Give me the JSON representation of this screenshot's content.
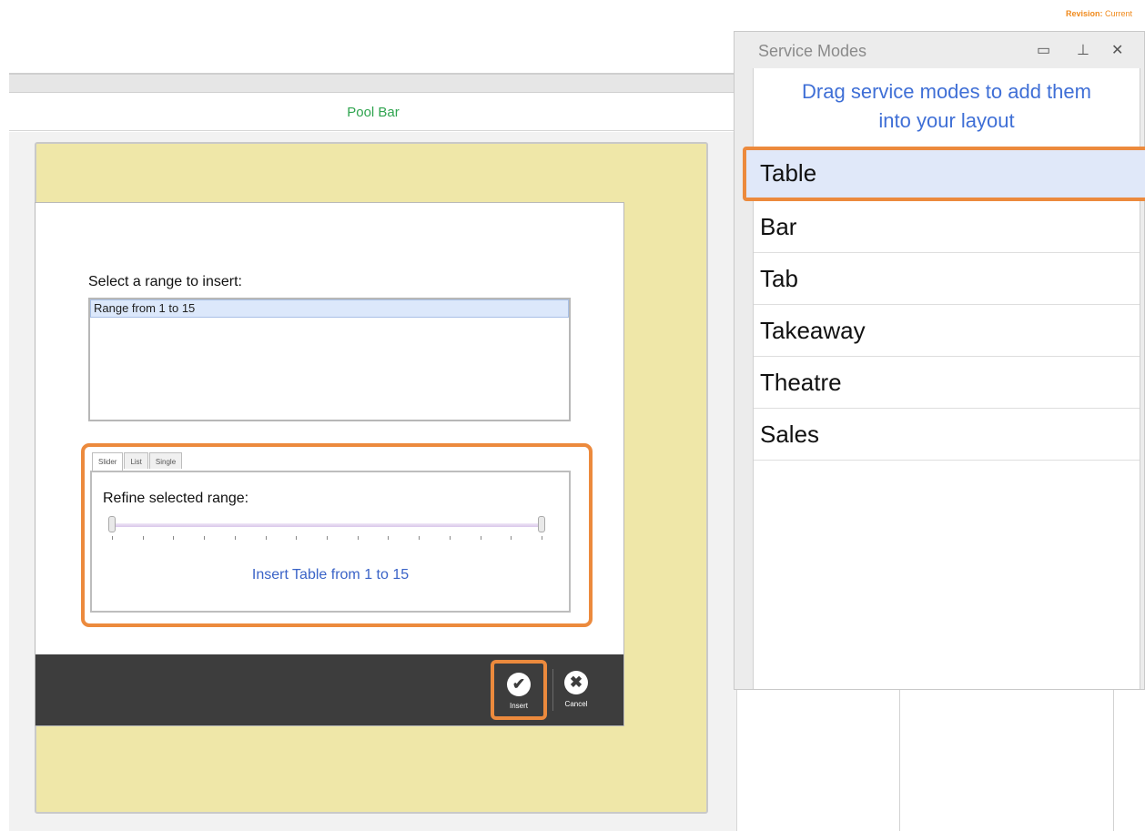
{
  "revision": {
    "label": "Revision:",
    "value": "Current"
  },
  "pool_bar": {
    "label": "Pool Bar"
  },
  "dialog": {
    "title": "Select a range to insert:",
    "ranges": [
      "Range from 1 to 15"
    ],
    "tabs": [
      "Slider",
      "List",
      "Single"
    ],
    "active_tab": "Slider",
    "refine_label": "Refine selected range:",
    "summary": "Insert Table from 1 to 15",
    "insert_label": "Insert",
    "cancel_label": "Cancel"
  },
  "service_modes": {
    "title": "Service Modes",
    "instruction_line1": "Drag service modes to add them",
    "instruction_line2": "into your layout",
    "items": [
      "Table",
      "Bar",
      "Tab",
      "Takeaway",
      "Theatre",
      "Sales"
    ],
    "selected": "Table"
  },
  "colors": {
    "highlight": "#ec8a3d",
    "accent_blue": "#3f6fd6",
    "pool_bar_green": "#2fa44f",
    "layout_yellow": "#efe7a8"
  }
}
